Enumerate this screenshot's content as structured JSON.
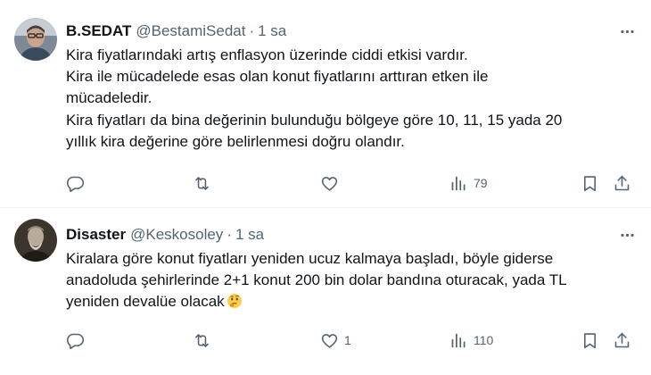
{
  "tweets": [
    {
      "name": "B.SEDAT",
      "handle": "@BestamiSedat",
      "separator": "·",
      "time": "1 sa",
      "avatar_icon": "profile-photo-man-glasses",
      "lines": [
        "Kira fiyatlarındaki artış enflasyon üzerinde ciddi etkisi vardır.",
        "Kira ile mücadelede esas olan konut fiyatlarını arttıran etken ile",
        "mücadeledir.",
        "Kira fiyatları da bina değerinin  bulunduğu bölgeye göre 10, 11, 15 yada 20",
        "yıllık kira değerine göre belirlenmesi doğru olandır."
      ],
      "replies": "",
      "retweets": "",
      "likes": "",
      "views": "79"
    },
    {
      "name": "Disaster",
      "handle": "@Keskosoley",
      "separator": "·",
      "time": "1 sa",
      "avatar_icon": "profile-photo-bearded-man-sepia",
      "lines": [
        "Kiralara göre konut fiyatları yeniden ucuz kalmaya başladı, böyle giderse",
        "anadoluda şehirlerinde 2+1 konut 200 bin dolar bandına oturacak, yada TL",
        "yeniden devalüe olacak"
      ],
      "emoji": "thinking-face",
      "replies": "",
      "retweets": "",
      "likes": "1",
      "views": "110"
    }
  ],
  "icons": {
    "more": "more-horizontal-icon",
    "reply": "reply-bubble-icon",
    "retweet": "retweet-icon",
    "like": "heart-icon",
    "views": "views-bar-chart-icon",
    "bookmark": "bookmark-icon",
    "share": "share-upload-icon"
  },
  "colors": {
    "text": "#0f1419",
    "secondary": "#536471",
    "divider": "#eff3f4"
  }
}
